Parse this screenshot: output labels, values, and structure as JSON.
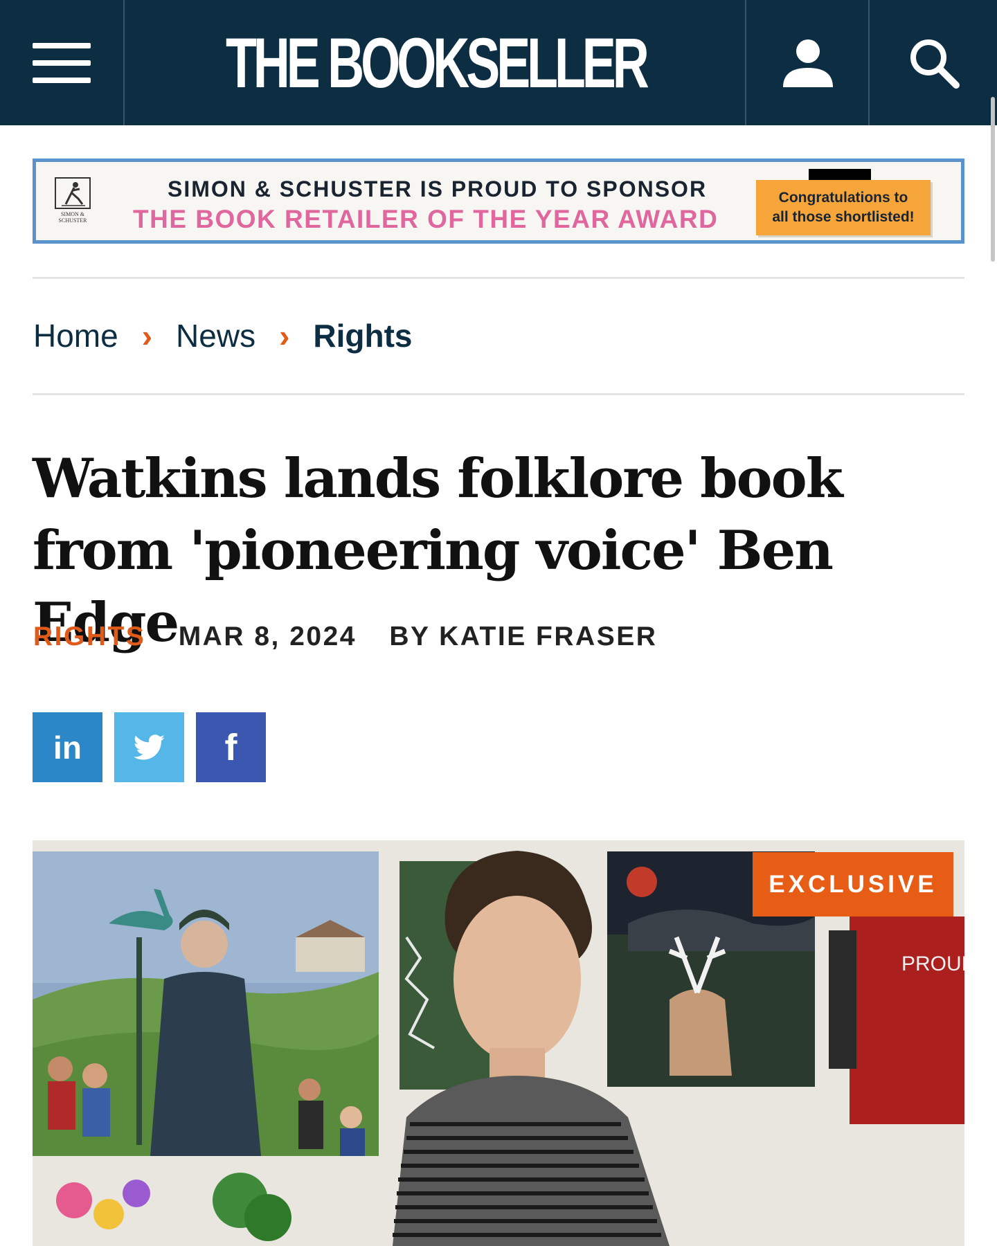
{
  "header": {
    "logo_text": "THE BOOKSELLER",
    "icons": [
      "menu-icon",
      "user-icon",
      "search-icon"
    ]
  },
  "ad": {
    "publisher_logo_text": "SIMON & SCHUSTER",
    "line1": "SIMON & SCHUSTER IS PROUD TO SPONSOR",
    "line2": "THE BOOK RETAILER OF THE YEAR AWARD",
    "congrats_line1": "Congratulations to",
    "congrats_line2": "all those shortlisted!"
  },
  "breadcrumb": {
    "items": [
      "Home",
      "News",
      "Rights"
    ],
    "separator": "›"
  },
  "article": {
    "headline": "Watkins lands folklore book from 'pioneering voice' Ben Edge",
    "category": "RIGHTS",
    "date": "MAR 8, 2024",
    "byline": "BY KATIE FRASER",
    "badge": "EXCLUSIVE",
    "painting_text": "PROUD BORN COCK"
  },
  "share": {
    "linkedin_label": "in",
    "facebook_label": "f"
  },
  "colors": {
    "header_bg": "#0d2d42",
    "accent_orange": "#e05a1a",
    "badge_orange": "#e85d16",
    "linkedin": "#2b87c8",
    "twitter": "#55b6e8",
    "facebook": "#3c57b0",
    "ad_border": "#5a93cc",
    "ad_pink": "#e0679e"
  }
}
